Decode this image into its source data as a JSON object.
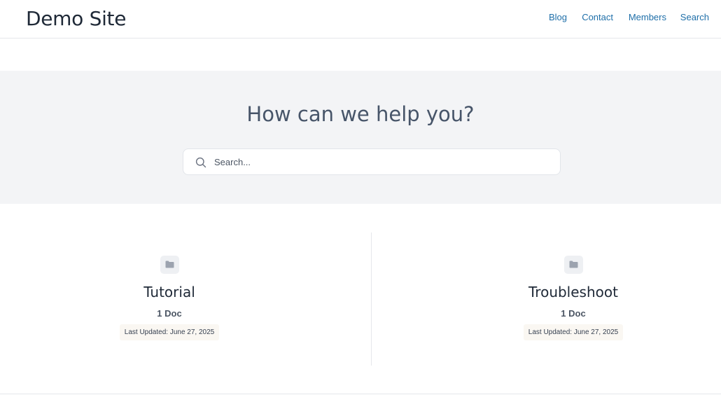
{
  "site": {
    "title": "Demo Site"
  },
  "nav": {
    "items": [
      {
        "label": "Blog"
      },
      {
        "label": "Contact"
      },
      {
        "label": "Members"
      },
      {
        "label": "Search"
      }
    ]
  },
  "hero": {
    "title": "How can we help you?",
    "search_placeholder": "Search..."
  },
  "categories": [
    {
      "title": "Tutorial",
      "count": "1 Doc",
      "updated": "Last Updated: June 27, 2025",
      "icon": "folder-icon"
    },
    {
      "title": "Troubleshoot",
      "count": "1 Doc",
      "updated": "Last Updated: June 27, 2025",
      "icon": "folder-icon"
    }
  ],
  "colors": {
    "link": "#1f6fa9",
    "hero_bg": "#f3f4f6",
    "badge_bg": "#faf7f2"
  }
}
